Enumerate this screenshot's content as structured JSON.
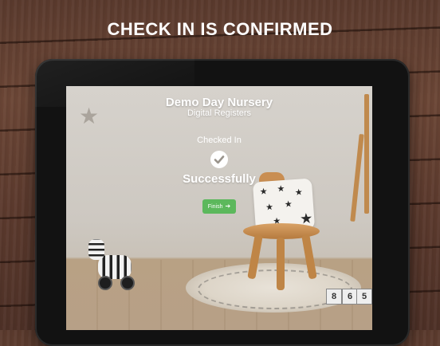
{
  "headline": "CHECK IN IS CONFIRMED",
  "nursery": {
    "name": "Demo Day Nursery",
    "subtitle": "Digital Registers"
  },
  "status": {
    "checked_label": "Checked In",
    "success_label": "Successfully",
    "icon": "check-circle-icon"
  },
  "finish_button": {
    "label": "Finish",
    "icon": "arrow-right-icon",
    "color": "#5cb85c"
  },
  "decor": {
    "toy_block_numbers": [
      "8",
      "6",
      "5"
    ]
  }
}
